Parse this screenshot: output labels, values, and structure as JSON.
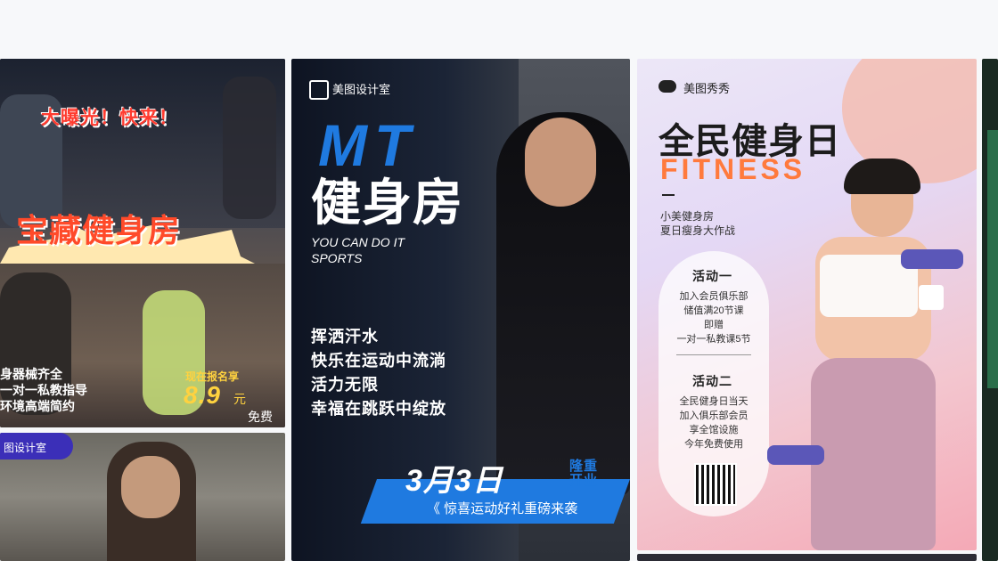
{
  "card1": {
    "banner": "大曝光！快来！",
    "title": "宝藏健身房",
    "features": [
      "身器械齐全",
      "一对一私教指导",
      "环境高端简约"
    ],
    "signup": "现在报名享",
    "price": "8.9",
    "price_unit": "元",
    "free": "免费"
  },
  "card1b": {
    "badge": "图设计室"
  },
  "card2": {
    "brand": "美图设计室",
    "title_en": "MT",
    "title_cn": "健身房",
    "tagline1": "YOU CAN DO IT",
    "tagline2": "SPORTS",
    "lines": [
      "挥洒汗水",
      "快乐在运动中流淌",
      "活力无限",
      "幸福在跳跃中绽放"
    ],
    "date": "3月3日",
    "date_tag": "隆重开业",
    "promo": "《 惊喜运动好礼重磅来袭"
  },
  "card3": {
    "brand": "美图秀秀",
    "title": "全民健身日",
    "subtitle_en": "FITNESS",
    "sub1": "小美健身房",
    "sub2": "夏日瘦身大作战",
    "act1_title": "活动一",
    "act1_lines": [
      "加入会员俱乐部",
      "储值满20节课",
      "即赠",
      "一对一私教课5节"
    ],
    "act2_title": "活动二",
    "act2_lines": [
      "全民健身日当天",
      "加入俱乐部会员",
      "享全馆设施",
      "今年免费使用"
    ]
  },
  "colors": {
    "accent_blue": "#1f7ae0",
    "accent_orange": "#ff7a3d",
    "yellow": "#ffd23f"
  }
}
